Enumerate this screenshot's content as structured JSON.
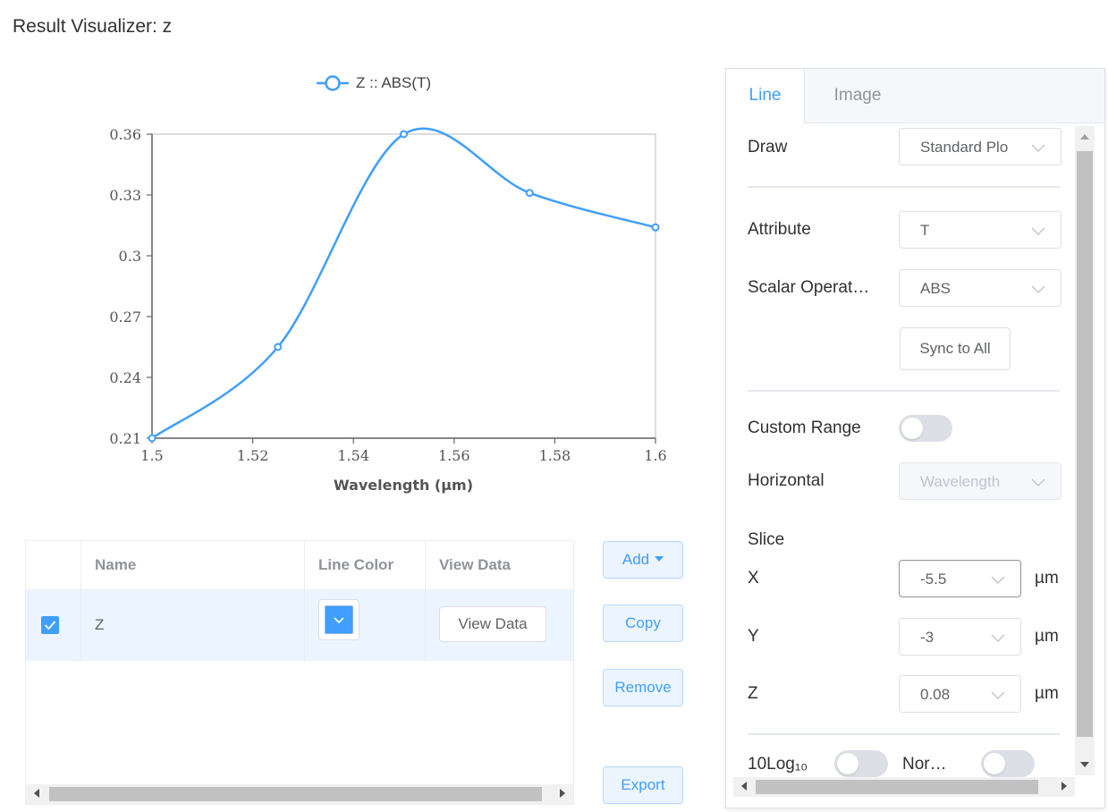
{
  "window": {
    "title": "Result Visualizer: z"
  },
  "chart_data": {
    "type": "line",
    "legend": "Z :: ABS(T)",
    "xlabel": "Wavelength (µm)",
    "ylabel": "",
    "xlim": [
      1.5,
      1.6
    ],
    "ylim": [
      0.21,
      0.36
    ],
    "x_ticks": [
      "1.5",
      "1.52",
      "1.54",
      "1.56",
      "1.58",
      "1.6"
    ],
    "y_ticks": [
      "0.21",
      "0.24",
      "0.27",
      "0.3",
      "0.33",
      "0.36"
    ],
    "series": [
      {
        "name": "Z :: ABS(T)",
        "color": "#409eff",
        "x": [
          1.5,
          1.525,
          1.55,
          1.575,
          1.6
        ],
        "y": [
          0.21,
          0.255,
          0.36,
          0.331,
          0.314
        ]
      }
    ],
    "grid": false,
    "legend_position": "top-center"
  },
  "table": {
    "headers": {
      "name": "Name",
      "line_color": "Line Color",
      "view_data": "View Data"
    },
    "rows": [
      {
        "checked": true,
        "name": "Z",
        "color": "#409eff",
        "view_label": "View Data"
      }
    ]
  },
  "actions": {
    "add": "Add",
    "copy": "Copy",
    "remove": "Remove",
    "export": "Export"
  },
  "panel": {
    "tabs": {
      "line": "Line",
      "image": "Image"
    },
    "draw": {
      "label": "Draw",
      "value": "Standard Plo"
    },
    "attribute": {
      "label": "Attribute",
      "value": "T"
    },
    "scalar": {
      "label": "Scalar Operat…",
      "value": "ABS"
    },
    "sync_label": "Sync to All",
    "custom_range": {
      "label": "Custom Range",
      "on": false
    },
    "horizontal": {
      "label": "Horizontal",
      "value": "Wavelength"
    },
    "slice": {
      "label": "Slice",
      "x": {
        "label": "X",
        "value": "-5.5",
        "unit": "µm"
      },
      "y": {
        "label": "Y",
        "value": "-3",
        "unit": "µm"
      },
      "z": {
        "label": "Z",
        "value": "0.08",
        "unit": "µm"
      }
    },
    "log_label": "10Log₁₀",
    "norm_label": "Nor…"
  },
  "colors": {
    "accent": "#409eff",
    "accent_light": "#ecf5ff"
  }
}
